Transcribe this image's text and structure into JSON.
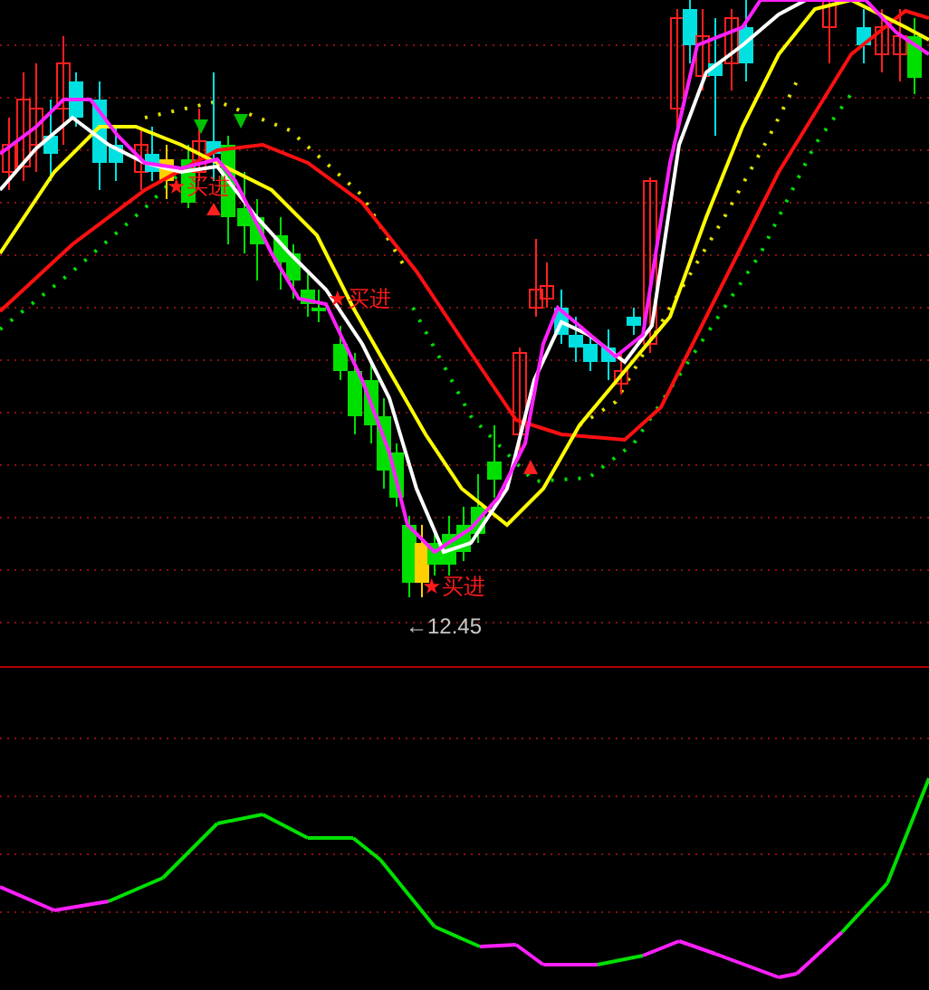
{
  "main_chart": {
    "signals": [
      {
        "label": "★买进"
      },
      {
        "label": "★买进"
      },
      {
        "label": "★买进"
      }
    ],
    "low_marker": {
      "text": "←12.45"
    }
  }
}
